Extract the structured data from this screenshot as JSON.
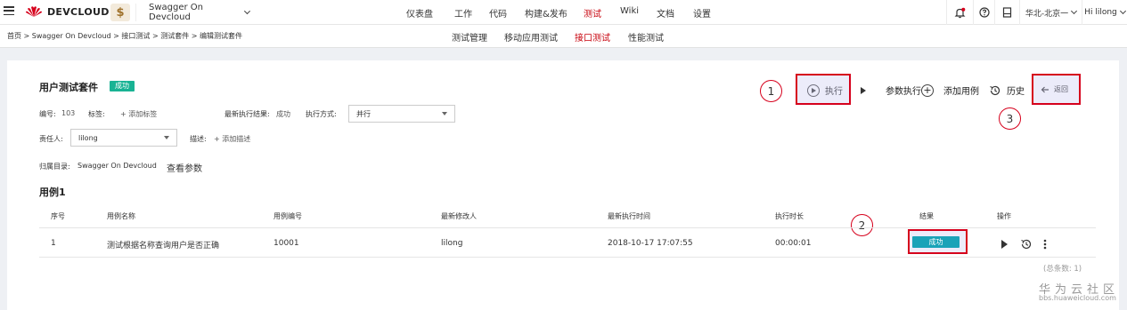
{
  "topbar": {
    "logo_text": "DEVCLOUD",
    "project_icon_glyph": "$",
    "project_name": "Swagger On Devcloud",
    "nav": [
      "仪表盘",
      "工作",
      "代码",
      "构建&发布",
      "测试",
      "Wiki",
      "文档",
      "设置"
    ],
    "active_nav": "测试",
    "region": "华北-北京一",
    "user": "Hi lilong"
  },
  "subbar": {
    "breadcrumb": "首页 > Swagger On Devcloud > 接口测试 > 测试套件 > 编辑测试套件",
    "tabs": [
      "测试管理",
      "移动应用测试",
      "接口测试",
      "性能测试"
    ],
    "active_tab": "接口测试"
  },
  "suite": {
    "title": "用户测试套件",
    "status": "成功",
    "id_label": "编号:",
    "id_value": "103",
    "tag_label": "标签:",
    "add_tag": "+ 添加标签",
    "last_result_label": "最新执行结果:",
    "last_result_value": "成功",
    "exec_mode_label": "执行方式:",
    "exec_mode_value": "并行",
    "owner_label": "责任人:",
    "owner_value": "lilong",
    "desc_label": "描述:",
    "add_desc": "+ 添加描述",
    "dir_label": "归属目录:",
    "dir_value": "Swagger On Devcloud",
    "view_params": "查看参数"
  },
  "actions": {
    "execute": "执行",
    "param_execute": "参数执行",
    "add_case": "添加用例",
    "history": "历史",
    "back": "返回"
  },
  "cases": {
    "section_title": "用例1",
    "columns": [
      "序号",
      "用例名称",
      "用例编号",
      "最新修改人",
      "最新执行时间",
      "执行时长",
      "结果",
      "操作"
    ],
    "rows": [
      {
        "index": "1",
        "name": "测试根据名称查询用户是否正确",
        "number": "10001",
        "modifier": "lilong",
        "time": "2018-10-17 17:07:55",
        "duration": "00:00:01",
        "result": "成功"
      }
    ],
    "total": "(总条数: 1)"
  },
  "annotations": [
    "1",
    "2",
    "3"
  ],
  "watermark": {
    "cn": "华为云社区",
    "en": "bbs.huaweicloud.com"
  },
  "colors": {
    "brand_red": "#c7000b",
    "success": "#19b394",
    "result_badge": "#1aa3b8",
    "highlight": "#d6001c"
  },
  "icons": [
    "menu-icon",
    "huawei-logo-icon",
    "caret-down-icon",
    "bell-icon",
    "help-icon",
    "device-icon",
    "play-icon",
    "add-icon",
    "history-icon",
    "back-arrow-icon",
    "more-icon"
  ]
}
